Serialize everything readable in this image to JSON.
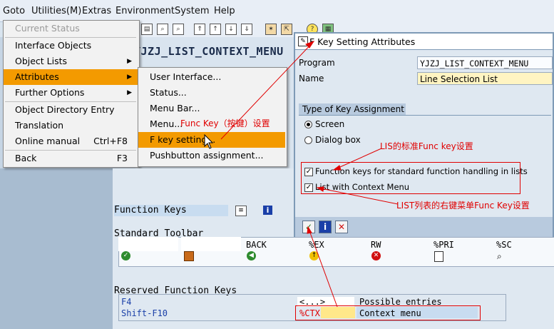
{
  "menubar": {
    "items": [
      "Goto",
      "Utilities(M)",
      "Extras",
      "Environment",
      "System",
      "Help"
    ]
  },
  "page_title": "YJZJ_LIST_CONTEXT_MENU",
  "goto_menu": {
    "items": [
      {
        "label": "Current Status",
        "disabled": true
      },
      {
        "label": "Interface Objects"
      },
      {
        "label": "Object Lists",
        "submenu": true
      },
      {
        "label": "Attributes",
        "submenu": true,
        "selected": true
      },
      {
        "label": "Further Options",
        "submenu": true
      },
      {
        "label": "Object Directory Entry"
      },
      {
        "label": "Translation"
      },
      {
        "label": "Online manual",
        "shortcut": "Ctrl+F8"
      },
      {
        "label": "Back",
        "shortcut": "F3"
      }
    ]
  },
  "attributes_menu": {
    "items": [
      {
        "label": "User Interface..."
      },
      {
        "label": "Status..."
      },
      {
        "label": "Menu Bar..."
      },
      {
        "label": "Menu..."
      },
      {
        "label": "F key setting...",
        "selected": true
      },
      {
        "label": "Pushbutton assignment..."
      }
    ]
  },
  "dialog": {
    "title": "F Key Setting Attributes",
    "program_label": "Program",
    "program_value": "YJZJ_LIST_CONTEXT_MENU",
    "name_label": "Name",
    "name_value": "Line Selection List",
    "group_title": "Type of Key Assignment",
    "radio_screen": "Screen",
    "radio_dialog": "Dialog box",
    "chk_function_keys": "Function keys for standard function handling in lists",
    "chk_context_menu": "List with Context Menu"
  },
  "content": {
    "function_keys": "Function Keys",
    "standard_toolbar": "Standard Toolbar",
    "toolbar_slots": [
      "BACK",
      "%EX",
      "RW",
      "%PRI",
      "%SC"
    ],
    "reserved_keys": "Reserved Function Keys",
    "rows": [
      {
        "key": "F4",
        "code": "<...>",
        "desc": "Possible entries"
      },
      {
        "key": "Shift-F10",
        "code": "%CTX",
        "desc": "Context menu"
      }
    ]
  },
  "annotations": {
    "func_key": "Func Key（按键）设置",
    "lis_std": "LIS的标准Func key设置",
    "list_right": "LIST列表的右键菜单Func Key设置"
  },
  "colors": {
    "menu_selected": "#f39a00",
    "annotation_red": "#e00000"
  }
}
